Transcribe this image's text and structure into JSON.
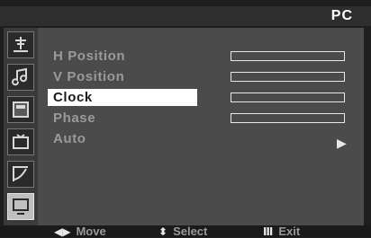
{
  "header": {
    "title": "PC"
  },
  "sidebar": {
    "icons": [
      {
        "name": "antenna-icon",
        "active": false
      },
      {
        "name": "music-note-icon",
        "active": false
      },
      {
        "name": "picture-icon",
        "active": false
      },
      {
        "name": "tv-setup-icon",
        "active": false
      },
      {
        "name": "sound-curve-icon",
        "active": false
      },
      {
        "name": "monitor-pc-icon",
        "active": true
      }
    ]
  },
  "menu": {
    "items": [
      {
        "label": "H Position",
        "selected": false,
        "has_bar": true
      },
      {
        "label": "V Position",
        "selected": false,
        "has_bar": true
      },
      {
        "label": "Clock",
        "selected": true,
        "has_bar": true
      },
      {
        "label": "Phase",
        "selected": false,
        "has_bar": true
      },
      {
        "label": "Auto",
        "selected": false,
        "has_bar": false
      }
    ],
    "auto_arrow": "▶"
  },
  "footer": {
    "move": {
      "glyph": "◀▶",
      "label": "Move"
    },
    "select": {
      "glyph": "⬍",
      "label": "Select"
    },
    "exit": {
      "glyph": "Ⅲ",
      "label": "Exit"
    }
  },
  "colors": {
    "panel": "#4b4b4b",
    "item_text": "#9a9a9a",
    "selected_bg": "#ffffff",
    "selected_text": "#1a1a1a"
  }
}
